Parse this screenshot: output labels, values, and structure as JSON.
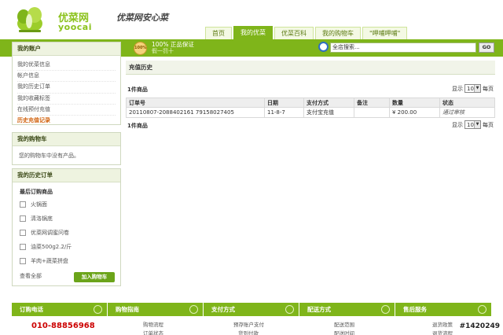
{
  "brand": {
    "name_cn": "优菜网",
    "name_en": "yoocai",
    "slogan": "优菜网安心菜"
  },
  "nav": {
    "tabs": [
      {
        "label": "首页",
        "active": false
      },
      {
        "label": "我的优菜",
        "active": true
      },
      {
        "label": "优菜百科",
        "active": false
      },
      {
        "label": "我的购物车",
        "active": false
      },
      {
        "label": "\"呷哺呷哺\"",
        "active": false
      }
    ]
  },
  "topbar": {
    "badge": "100%",
    "guarantee_title": "100% 正品保证",
    "guarantee_sub": "假一罚十",
    "search_value": "全店搜索...",
    "go_label": "GO"
  },
  "sidebar": {
    "account": {
      "title": "我的账户",
      "items": [
        {
          "label": "我的优菜信息",
          "active": false
        },
        {
          "label": "帐户信息",
          "active": false
        },
        {
          "label": "我的历史订单",
          "active": false
        },
        {
          "label": "我的收藏标签",
          "active": false
        },
        {
          "label": "在线预付充值",
          "active": false
        },
        {
          "label": "历史充值记录",
          "active": true
        }
      ]
    },
    "cart": {
      "title": "我的购物车",
      "empty_text": "您的购物车中没有产品。"
    },
    "history": {
      "title": "我的历史订单",
      "subtitle": "最后订购商品",
      "items": [
        "火锅面",
        "清洛锅底",
        "优菜网调蜜问卷",
        "油菜500g2.2/斤",
        "羊肉+蔬菜拼盘"
      ],
      "see_all": "查看全部",
      "add_to_cart": "加入购物车"
    }
  },
  "main": {
    "title": "充值历史",
    "count_top": "1件商品",
    "count_bottom": "1件商品",
    "pager": {
      "show": "显示",
      "value": "10",
      "per_page": "每页"
    },
    "columns": [
      "订单号",
      "日期",
      "支付方式",
      "备注",
      "数量",
      "状态"
    ],
    "rows": [
      {
        "order": "20110807-2088402161 79158027405",
        "date": "11-8-7",
        "payment": "支付宝充值",
        "note": "",
        "amount": "¥ 200.00",
        "status": "通过审核"
      }
    ]
  },
  "footer": {
    "columns": [
      "订购电话",
      "购物指南",
      "支付方式",
      "配送方式",
      "售后服务"
    ],
    "phone": "010-88856968",
    "links": {
      "guide": [
        "购物流程",
        "订单状态"
      ],
      "payment": [
        "预存账户支付",
        "货到付款"
      ],
      "delivery": [
        "配送范围",
        "配送时间"
      ],
      "service": [
        "退货政策",
        "退货流程"
      ]
    }
  },
  "watermark": "#1420249"
}
